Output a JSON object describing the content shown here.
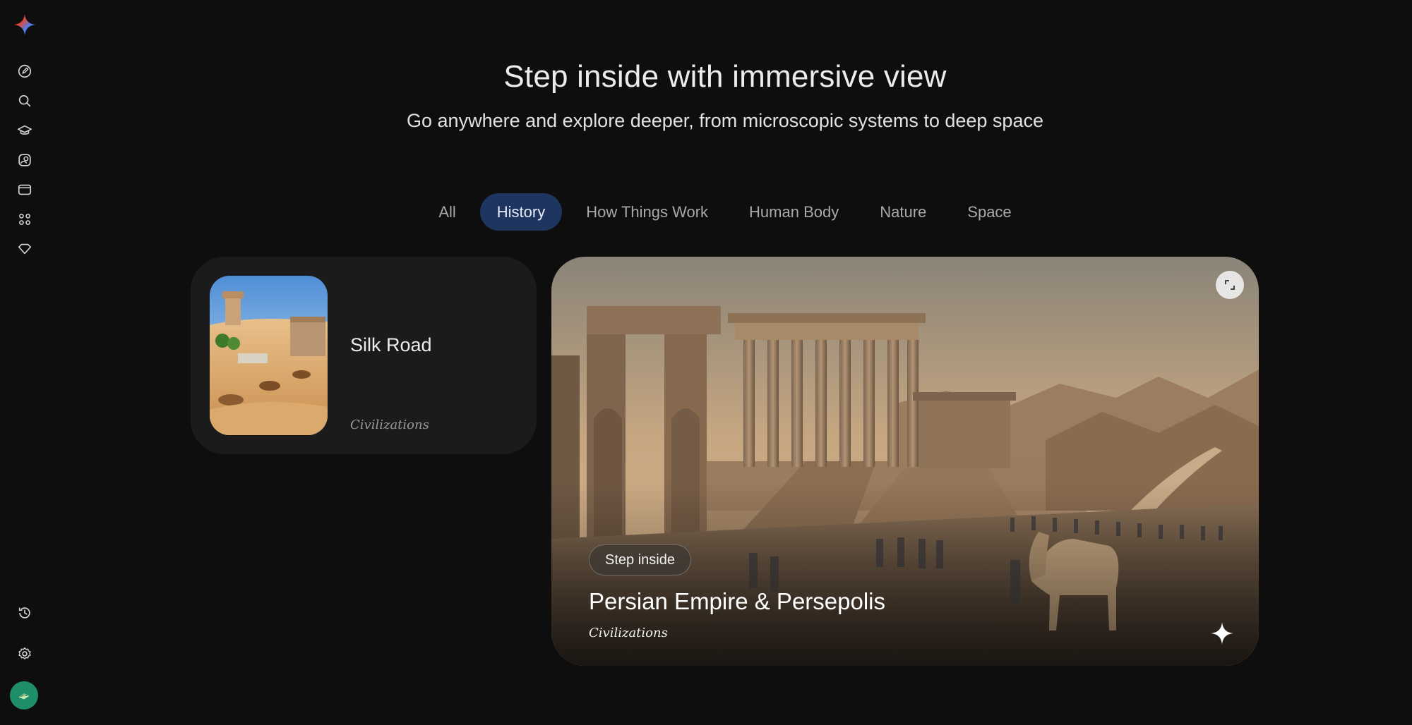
{
  "header": {
    "title": "Step inside with immersive view",
    "subtitle": "Go anywhere and explore deeper, from microscopic systems to deep space"
  },
  "sidebar": {
    "items": [
      {
        "icon": "edit-icon"
      },
      {
        "icon": "search-icon"
      },
      {
        "icon": "graduation-cap-icon"
      },
      {
        "icon": "gallery-icon"
      },
      {
        "icon": "video-icon"
      },
      {
        "icon": "apps-grid-icon"
      },
      {
        "icon": "diamond-icon"
      }
    ],
    "bottom": [
      {
        "icon": "history-icon"
      },
      {
        "icon": "settings-icon"
      }
    ]
  },
  "tabs": [
    {
      "label": "All",
      "active": false
    },
    {
      "label": "History",
      "active": true
    },
    {
      "label": "How Things Work",
      "active": false
    },
    {
      "label": "Human Body",
      "active": false
    },
    {
      "label": "Nature",
      "active": false
    },
    {
      "label": "Space",
      "active": false
    }
  ],
  "cards": {
    "small": {
      "title": "Silk Road",
      "category": "Civilizations"
    },
    "hero": {
      "button": "Step inside",
      "title": "Persian Empire & Persepolis",
      "category": "Civilizations"
    }
  },
  "colors": {
    "background": "#0e0e0e",
    "active_tab": "#1e3560",
    "card": "#1b1b1b",
    "avatar": "#1f8f6a"
  }
}
